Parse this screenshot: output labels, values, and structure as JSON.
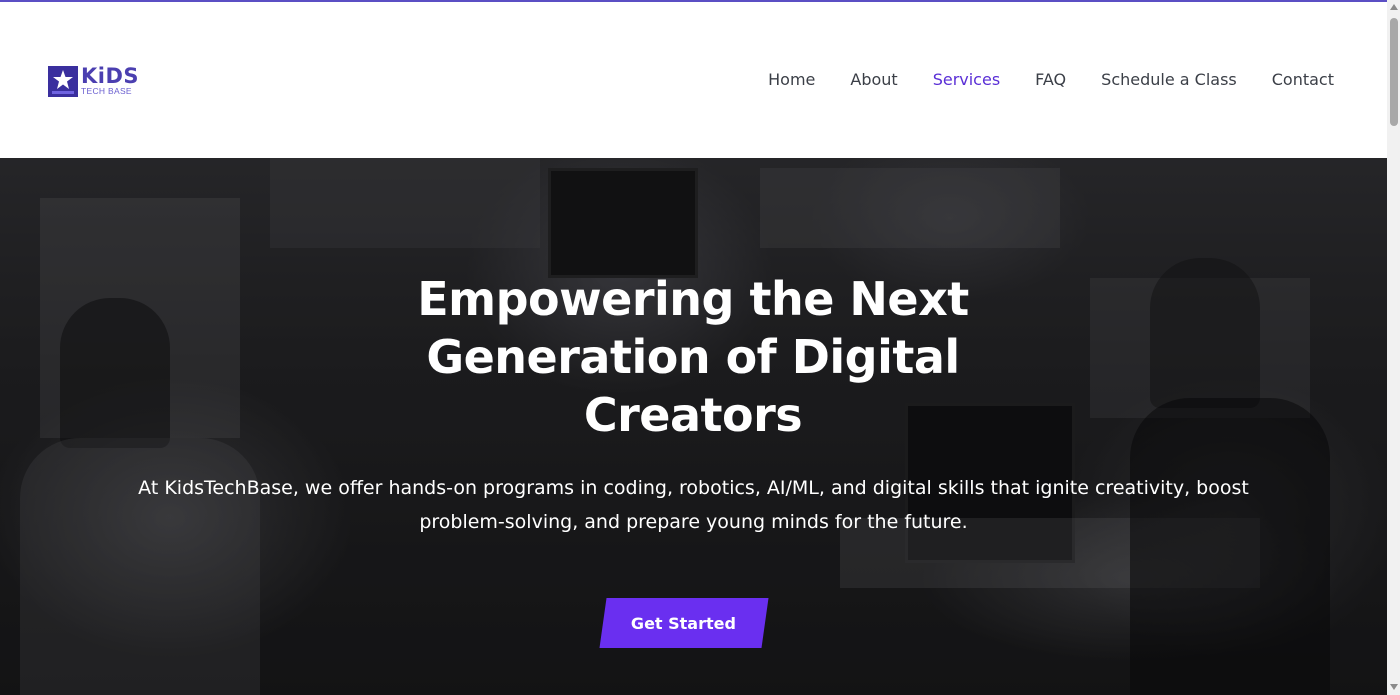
{
  "brand": {
    "word": "KiDS",
    "sub": "TECH BASE",
    "mark_text": "KTB",
    "color": "#4b3fb0"
  },
  "nav": {
    "items": [
      {
        "label": "Home"
      },
      {
        "label": "About"
      },
      {
        "label": "Services",
        "active": true
      },
      {
        "label": "FAQ"
      },
      {
        "label": "Schedule a Class"
      },
      {
        "label": "Contact"
      }
    ],
    "active_color": "#5a2fd6"
  },
  "hero": {
    "title": "Empowering the Next Generation of Digital Creators",
    "description": "At KidsTechBase, we offer hands-on programs in coding, robotics, AI/ML, and digital skills that ignite creativity, boost problem-solving, and prepare young minds for the future.",
    "cta_label": "Get Started",
    "cta_color": "#6a2ff0"
  }
}
